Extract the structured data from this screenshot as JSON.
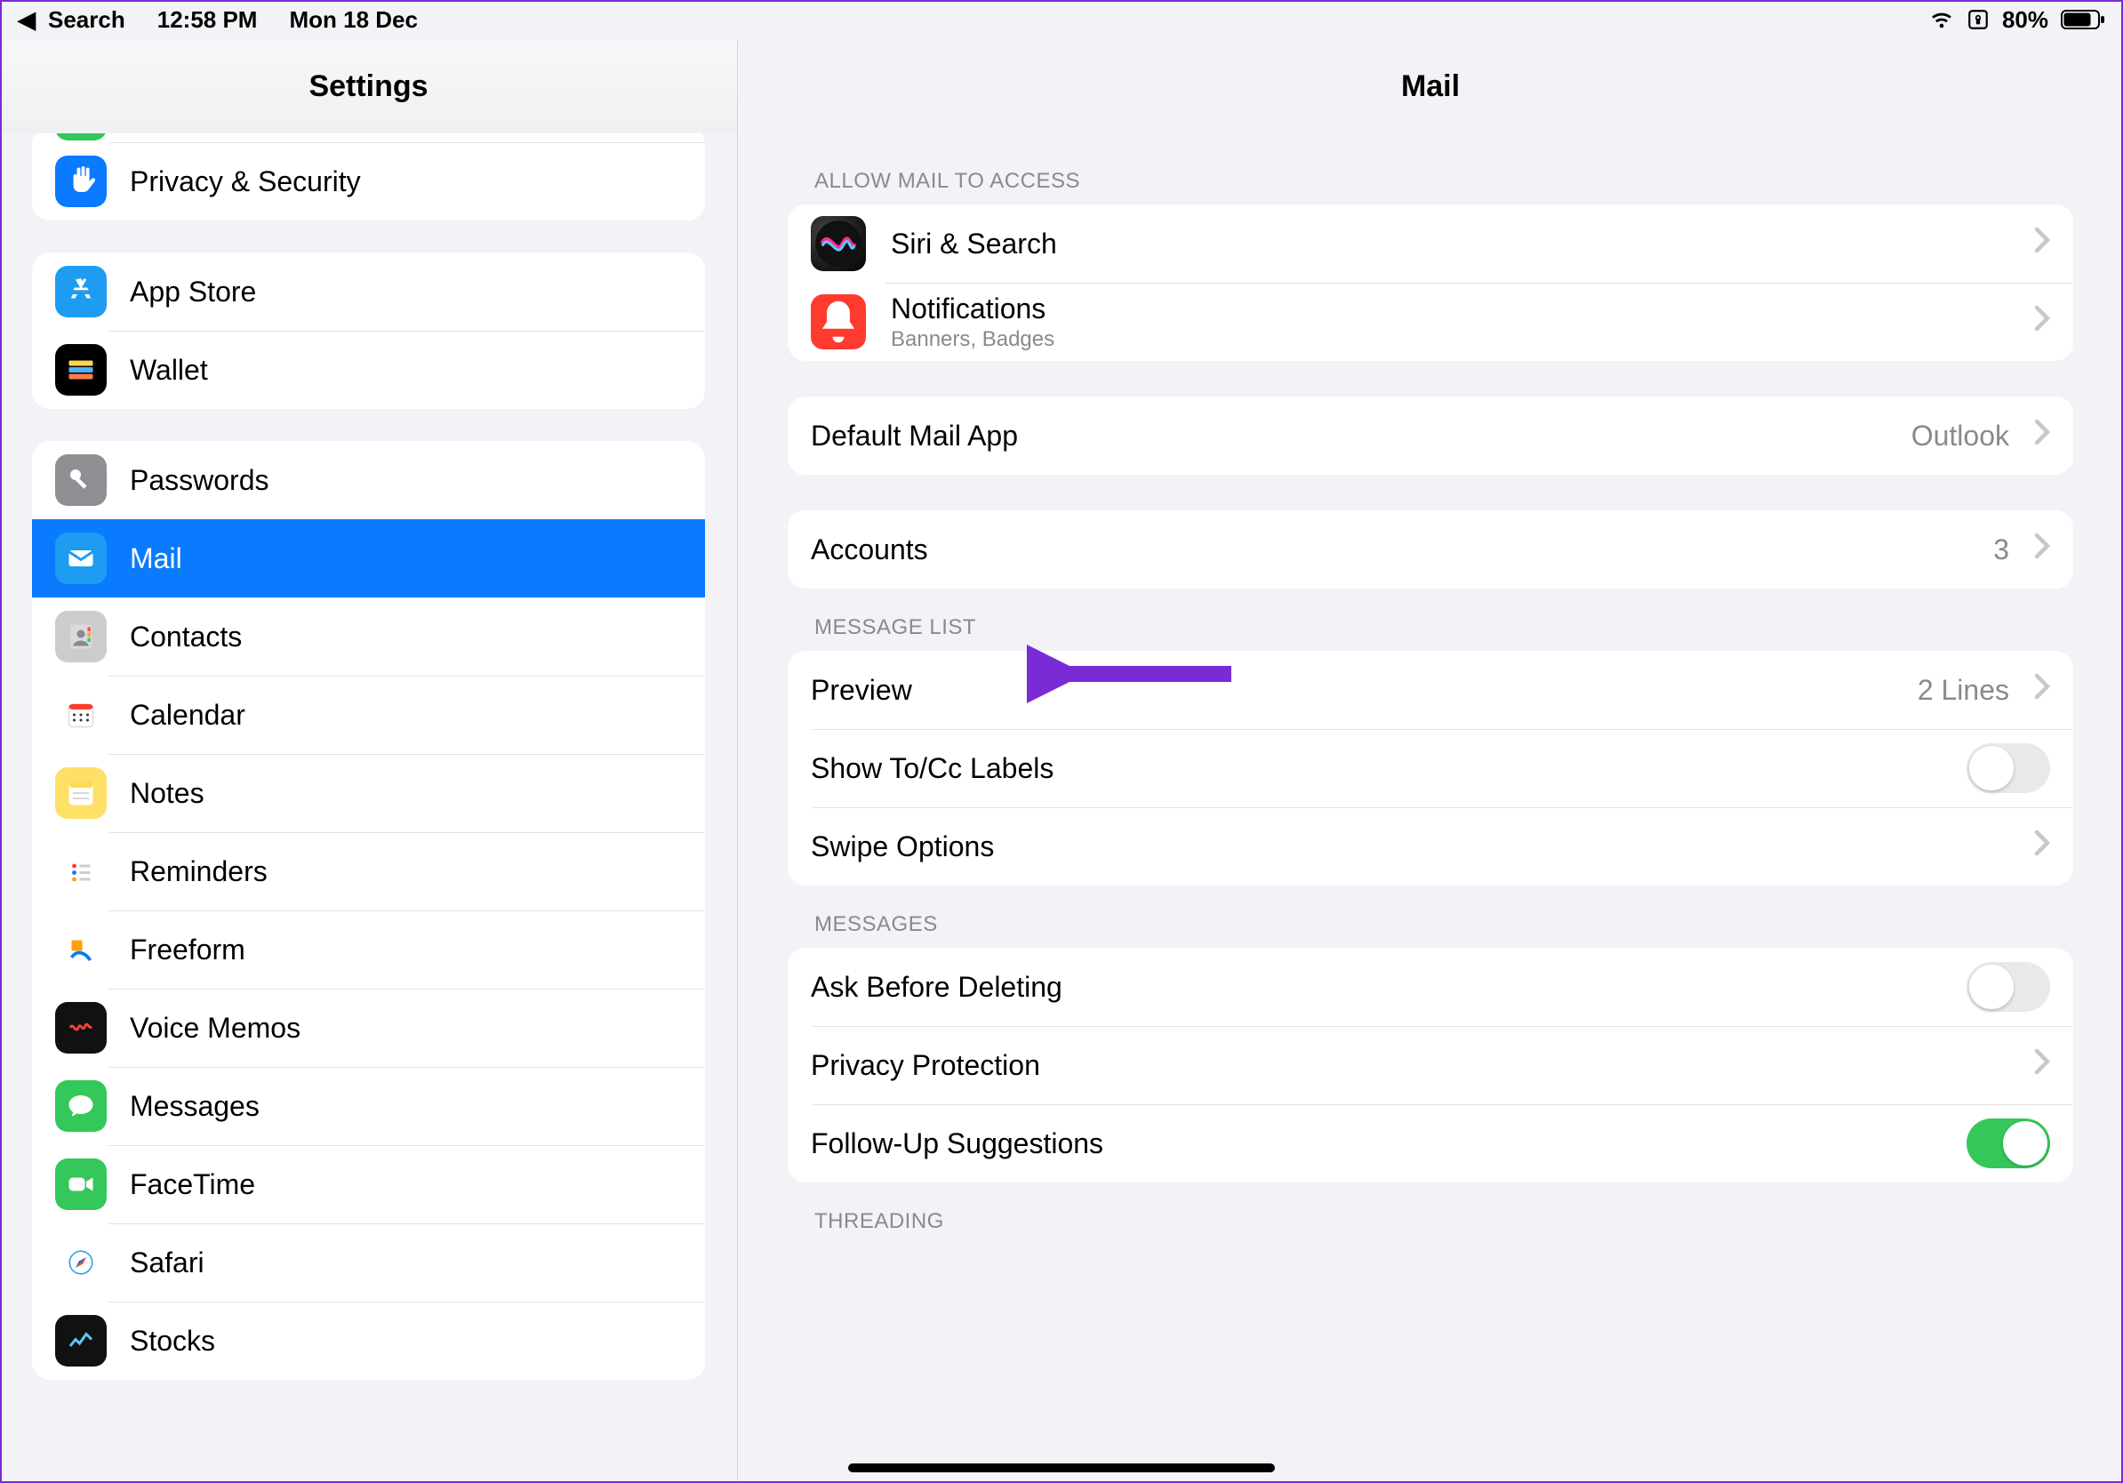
{
  "statusbar": {
    "back": "Search",
    "time": "12:58 PM",
    "date": "Mon 18 Dec",
    "battery": "80%"
  },
  "sidebar": {
    "title": "Settings",
    "groups": [
      {
        "items": [
          {
            "name": "privacy-partial",
            "label": "",
            "iconBg": "#34c759",
            "icon": ""
          },
          {
            "name": "privacy-security",
            "label": "Privacy & Security",
            "iconBg": "#0a7aff",
            "icon": "hand"
          }
        ]
      },
      {
        "items": [
          {
            "name": "app-store",
            "label": "App Store",
            "iconBg": "#1e9cf1",
            "icon": "appstore"
          },
          {
            "name": "wallet",
            "label": "Wallet",
            "iconBg": "#000",
            "icon": "wallet"
          }
        ]
      },
      {
        "items": [
          {
            "name": "passwords",
            "label": "Passwords",
            "iconBg": "#8e8e93",
            "icon": "key"
          },
          {
            "name": "mail",
            "label": "Mail",
            "iconBg": "#1e9cf1",
            "icon": "mail",
            "selected": true
          },
          {
            "name": "contacts",
            "label": "Contacts",
            "iconBg": "#ccc",
            "icon": "contacts"
          },
          {
            "name": "calendar",
            "label": "Calendar",
            "iconBg": "#fff",
            "icon": "calendar"
          },
          {
            "name": "notes",
            "label": "Notes",
            "iconBg": "#ffe066",
            "icon": "notes"
          },
          {
            "name": "reminders",
            "label": "Reminders",
            "iconBg": "#fff",
            "icon": "reminders"
          },
          {
            "name": "freeform",
            "label": "Freeform",
            "iconBg": "#fff",
            "icon": "freeform"
          },
          {
            "name": "voice-memos",
            "label": "Voice Memos",
            "iconBg": "#111",
            "icon": "voicememos"
          },
          {
            "name": "messages",
            "label": "Messages",
            "iconBg": "#34c759",
            "icon": "messages"
          },
          {
            "name": "facetime",
            "label": "FaceTime",
            "iconBg": "#34c759",
            "icon": "facetime"
          },
          {
            "name": "safari",
            "label": "Safari",
            "iconBg": "#fff",
            "icon": "safari"
          },
          {
            "name": "stocks",
            "label": "Stocks",
            "iconBg": "#111",
            "icon": "stocks"
          }
        ]
      }
    ]
  },
  "detail": {
    "title": "Mail",
    "sections": [
      {
        "header": "ALLOW MAIL TO ACCESS",
        "rows": [
          {
            "name": "siri-search",
            "label": "Siri & Search",
            "icon": "siri",
            "chev": true,
            "withIcon": true
          },
          {
            "name": "notifications",
            "label": "Notifications",
            "sub": "Banners, Badges",
            "icon": "bell",
            "iconBg": "#ff3b30",
            "chev": true,
            "withIcon": true
          }
        ]
      },
      {
        "header": null,
        "rows": [
          {
            "name": "default-mail-app",
            "label": "Default Mail App",
            "value": "Outlook",
            "chev": true
          }
        ]
      },
      {
        "header": null,
        "rows": [
          {
            "name": "accounts",
            "label": "Accounts",
            "value": "3",
            "chev": true
          }
        ]
      },
      {
        "header": "MESSAGE LIST",
        "rows": [
          {
            "name": "preview",
            "label": "Preview",
            "value": "2 Lines",
            "chev": true
          },
          {
            "name": "show-tocc",
            "label": "Show To/Cc Labels",
            "switch": false
          },
          {
            "name": "swipe-options",
            "label": "Swipe Options",
            "chev": true
          }
        ]
      },
      {
        "header": "MESSAGES",
        "rows": [
          {
            "name": "ask-before-deleting",
            "label": "Ask Before Deleting",
            "switch": false
          },
          {
            "name": "privacy-protection",
            "label": "Privacy Protection",
            "chev": true
          },
          {
            "name": "follow-up",
            "label": "Follow-Up Suggestions",
            "switch": true
          }
        ]
      },
      {
        "header": "THREADING",
        "rows": []
      }
    ]
  }
}
